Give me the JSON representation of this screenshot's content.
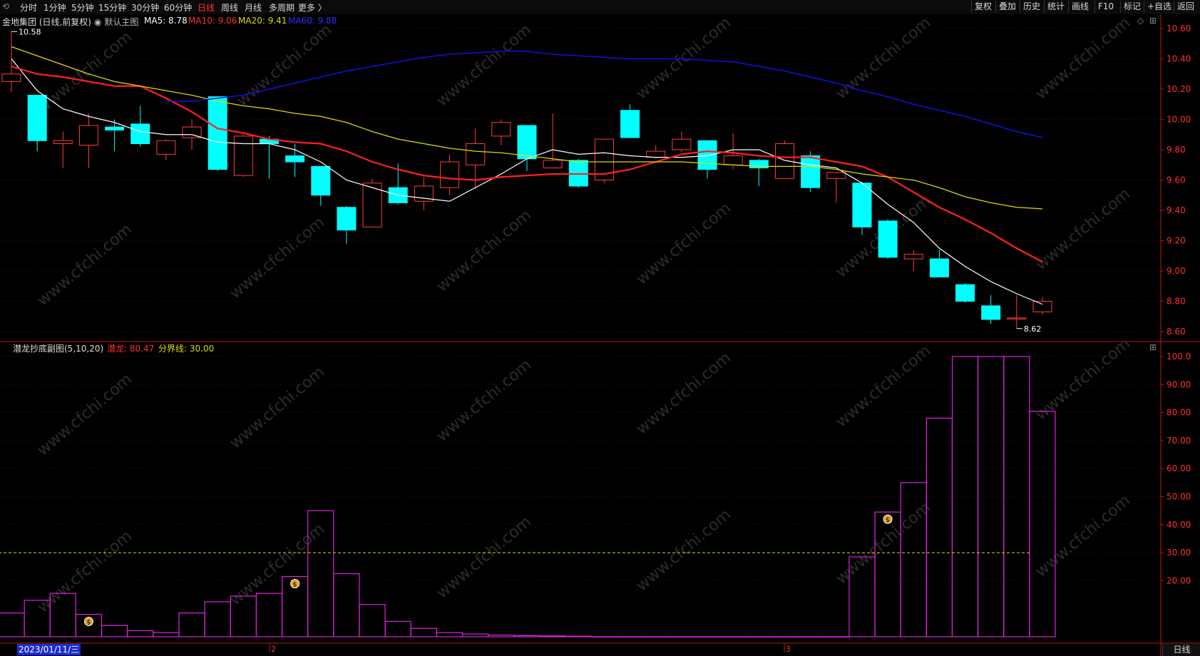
{
  "toolbar": {
    "left_items": [
      "分时",
      "1分钟",
      "5分钟",
      "15分钟",
      "30分钟",
      "60分钟",
      "日线",
      "周线",
      "月线",
      "多周期",
      "更多 〉"
    ],
    "active": "日线",
    "right_items": [
      "复权",
      "叠加",
      "历史",
      "统计",
      "画线",
      "F10",
      "标记",
      "+自选",
      "返回"
    ]
  },
  "main_header": {
    "stock": "金地集团 (日线,前复权)",
    "template": "默认主图",
    "ma5": "MA5: 8.78",
    "ma10": "MA10: 9.06",
    "ma20": "MA20: 9.41",
    "ma60": "MA60: 9.88",
    "high_mark": "10.58",
    "low_mark": "8.62"
  },
  "sub_header": {
    "name": "潜龙抄底副图(5,10,20)",
    "qianlong": "潜龙: 80.47",
    "threshold": "分界线: 30.00"
  },
  "axis": {
    "price_ticks": [
      "10.60",
      "10.40",
      "10.20",
      "10.00",
      "9.80",
      "9.60",
      "9.40",
      "9.20",
      "9.00",
      "8.80",
      "8.60"
    ],
    "ind_ticks": [
      "100.0",
      "90.00",
      "80.00",
      "70.00",
      "60.00",
      "50.00",
      "40.00",
      "30.00",
      "20.00"
    ],
    "date_label": "2023/01/11/三",
    "month_marks": [
      "2",
      "3"
    ]
  },
  "bottom_tab": "日线",
  "watermark": "www.cfchi.com",
  "colors": {
    "up": "#ff3b3b",
    "down": "#00ffff",
    "ma5": "#ffffff",
    "ma10": "#ff2020",
    "ma20": "#dddd00",
    "ma60": "#1010e0",
    "indicator": "#dd22dd"
  },
  "chart_data": [
    {
      "type": "candlestick",
      "title": "金地集团 (日线,前复权)",
      "ylim": [
        8.55,
        10.65
      ],
      "candles": [
        {
          "o": 10.25,
          "h": 10.58,
          "l": 10.18,
          "c": 10.3
        },
        {
          "o": 10.16,
          "h": 10.16,
          "l": 9.79,
          "c": 9.86
        },
        {
          "o": 9.84,
          "h": 9.92,
          "l": 9.68,
          "c": 9.86
        },
        {
          "o": 9.83,
          "h": 10.04,
          "l": 9.68,
          "c": 9.96
        },
        {
          "o": 9.95,
          "h": 10.0,
          "l": 9.79,
          "c": 9.93
        },
        {
          "o": 9.97,
          "h": 10.09,
          "l": 9.82,
          "c": 9.84
        },
        {
          "o": 9.77,
          "h": 9.87,
          "l": 9.73,
          "c": 9.86
        },
        {
          "o": 9.88,
          "h": 10.0,
          "l": 9.8,
          "c": 9.95
        },
        {
          "o": 10.15,
          "h": 10.15,
          "l": 9.66,
          "c": 9.67
        },
        {
          "o": 9.63,
          "h": 9.9,
          "l": 9.62,
          "c": 9.89
        },
        {
          "o": 9.87,
          "h": 9.89,
          "l": 9.61,
          "c": 9.84
        },
        {
          "o": 9.76,
          "h": 9.84,
          "l": 9.62,
          "c": 9.72
        },
        {
          "o": 9.69,
          "h": 9.69,
          "l": 9.43,
          "c": 9.5
        },
        {
          "o": 9.42,
          "h": 9.43,
          "l": 9.18,
          "c": 9.27
        },
        {
          "o": 9.29,
          "h": 9.61,
          "l": 9.29,
          "c": 9.58
        },
        {
          "o": 9.55,
          "h": 9.71,
          "l": 9.44,
          "c": 9.45
        },
        {
          "o": 9.46,
          "h": 9.62,
          "l": 9.4,
          "c": 9.56
        },
        {
          "o": 9.55,
          "h": 9.77,
          "l": 9.5,
          "c": 9.72
        },
        {
          "o": 9.7,
          "h": 9.94,
          "l": 9.54,
          "c": 9.84
        },
        {
          "o": 9.89,
          "h": 10.0,
          "l": 9.83,
          "c": 9.98
        },
        {
          "o": 9.96,
          "h": 9.96,
          "l": 9.66,
          "c": 9.74
        },
        {
          "o": 9.68,
          "h": 10.04,
          "l": 9.68,
          "c": 9.73
        },
        {
          "o": 9.73,
          "h": 9.74,
          "l": 9.55,
          "c": 9.56
        },
        {
          "o": 9.6,
          "h": 9.87,
          "l": 9.58,
          "c": 9.87
        },
        {
          "o": 10.06,
          "h": 10.1,
          "l": 9.88,
          "c": 9.88
        },
        {
          "o": 9.75,
          "h": 9.83,
          "l": 9.74,
          "c": 9.79
        },
        {
          "o": 9.8,
          "h": 9.92,
          "l": 9.78,
          "c": 9.87
        },
        {
          "o": 9.86,
          "h": 9.86,
          "l": 9.61,
          "c": 9.67
        },
        {
          "o": 9.7,
          "h": 9.91,
          "l": 9.67,
          "c": 9.76
        },
        {
          "o": 9.73,
          "h": 9.74,
          "l": 9.56,
          "c": 9.68
        },
        {
          "o": 9.61,
          "h": 9.86,
          "l": 9.61,
          "c": 9.84
        },
        {
          "o": 9.76,
          "h": 9.79,
          "l": 9.52,
          "c": 9.55
        },
        {
          "o": 9.61,
          "h": 9.63,
          "l": 9.45,
          "c": 9.65
        },
        {
          "o": 9.58,
          "h": 9.59,
          "l": 9.24,
          "c": 9.29
        },
        {
          "o": 9.33,
          "h": 9.34,
          "l": 9.08,
          "c": 9.09
        },
        {
          "o": 9.08,
          "h": 9.14,
          "l": 9.0,
          "c": 9.11
        },
        {
          "o": 9.08,
          "h": 9.14,
          "l": 8.96,
          "c": 8.96
        },
        {
          "o": 8.91,
          "h": 8.92,
          "l": 8.79,
          "c": 8.8
        },
        {
          "o": 8.77,
          "h": 8.84,
          "l": 8.65,
          "c": 8.68
        },
        {
          "o": 8.69,
          "h": 8.84,
          "l": 8.62,
          "c": 8.69
        },
        {
          "o": 8.73,
          "h": 8.83,
          "l": 8.71,
          "c": 8.8
        }
      ],
      "series": [
        {
          "name": "MA5",
          "values": [
            10.4,
            10.19,
            10.07,
            10.02,
            9.98,
            9.92,
            9.9,
            9.9,
            9.85,
            9.84,
            9.84,
            9.8,
            9.72,
            9.6,
            9.55,
            9.5,
            9.48,
            9.46,
            9.55,
            9.64,
            9.74,
            9.8,
            9.77,
            9.78,
            9.76,
            9.75,
            9.75,
            9.76,
            9.8,
            9.8,
            9.73,
            9.7,
            9.68,
            9.58,
            9.44,
            9.32,
            9.15,
            9.03,
            8.93,
            8.85,
            8.78
          ]
        },
        {
          "name": "MA10",
          "values": [
            10.35,
            10.3,
            10.28,
            10.25,
            10.22,
            10.22,
            10.14,
            10.05,
            9.94,
            9.91,
            9.87,
            9.85,
            9.84,
            9.79,
            9.72,
            9.67,
            9.63,
            9.61,
            9.6,
            9.62,
            9.63,
            9.64,
            9.64,
            9.64,
            9.67,
            9.72,
            9.77,
            9.79,
            9.78,
            9.76,
            9.75,
            9.75,
            9.72,
            9.69,
            9.62,
            9.52,
            9.42,
            9.34,
            9.25,
            9.15,
            9.06
          ]
        },
        {
          "name": "MA20",
          "values": [
            10.48,
            10.42,
            10.36,
            10.3,
            10.25,
            10.22,
            10.19,
            10.16,
            10.12,
            10.09,
            10.07,
            10.04,
            10.02,
            9.98,
            9.92,
            9.87,
            9.84,
            9.81,
            9.79,
            9.78,
            9.76,
            9.74,
            9.72,
            9.72,
            9.72,
            9.72,
            9.72,
            9.71,
            9.7,
            9.69,
            9.69,
            9.69,
            9.67,
            9.64,
            9.62,
            9.6,
            9.55,
            9.49,
            9.45,
            9.42,
            9.41
          ]
        },
        {
          "name": "MA60",
          "values": [
            10.12,
            10.12,
            10.14,
            10.16,
            10.2,
            10.24,
            10.28,
            10.32,
            10.35,
            10.38,
            10.41,
            10.43,
            10.44,
            10.45,
            10.45,
            10.43,
            10.42,
            10.41,
            10.4,
            10.4,
            10.4,
            10.39,
            10.38,
            10.35,
            10.32,
            10.28,
            10.24,
            10.19,
            10.15,
            10.1,
            10.06,
            10.02,
            9.97,
            9.92,
            9.88
          ]
        }
      ]
    },
    {
      "type": "bar",
      "title": "潜龙抄底副图(5,10,20)",
      "ylim": [
        0,
        103
      ],
      "threshold": 30,
      "values": [
        8.5,
        13,
        15.5,
        8,
        4,
        2.2,
        1.5,
        8.5,
        12.5,
        14.5,
        15.5,
        21.5,
        45,
        22.5,
        11.5,
        5.5,
        3,
        1.5,
        1,
        0.6,
        0.4,
        0.3,
        0.2,
        0,
        0,
        0,
        0,
        0,
        0,
        0,
        0,
        0,
        0,
        28.5,
        44.5,
        55,
        78,
        100,
        100,
        100,
        80.47
      ],
      "markers": [
        3,
        11,
        34
      ]
    }
  ]
}
